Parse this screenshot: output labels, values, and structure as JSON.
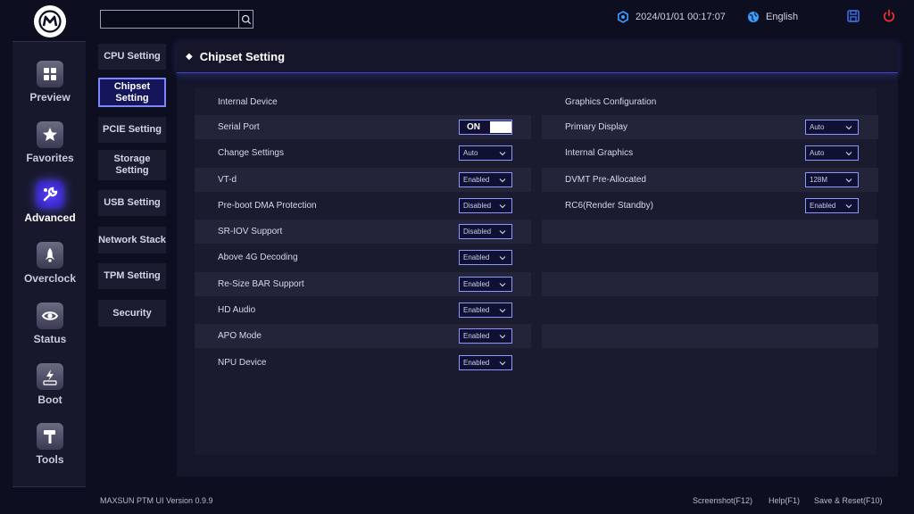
{
  "brand": {
    "colors": {
      "accent": "#5b4bff",
      "power": "#e53030",
      "save": "#3a6ee8"
    }
  },
  "search": {
    "value": "",
    "placeholder": ""
  },
  "topbar": {
    "datetime": "2024/01/01 00:17:07",
    "language": "English"
  },
  "sidebar": {
    "items": [
      {
        "label": "Preview",
        "icon": "grid-icon"
      },
      {
        "label": "Favorites",
        "icon": "star-icon"
      },
      {
        "label": "Advanced",
        "icon": "wrench-icon"
      },
      {
        "label": "Overclock",
        "icon": "rocket-icon"
      },
      {
        "label": "Status",
        "icon": "eye-icon"
      },
      {
        "label": "Boot",
        "icon": "ssd-icon"
      },
      {
        "label": "Tools",
        "icon": "hammer-icon"
      }
    ],
    "active": "Advanced"
  },
  "submenu": {
    "items": [
      "CPU Setting",
      "Chipset Setting",
      "PCIE Setting",
      "Storage Setting",
      "USB Setting",
      "Network Stack",
      "TPM Setting",
      "Security"
    ],
    "active": "Chipset Setting"
  },
  "panel": {
    "title": "Chipset Setting",
    "left": {
      "heading": "Internal Device",
      "rows": [
        {
          "label": "Serial Port",
          "value": "ON",
          "control": "toggle"
        },
        {
          "label": "Change Settings",
          "value": "Auto"
        },
        {
          "label": "VT-d",
          "value": "Enabled"
        },
        {
          "label": "Pre-boot DMA Protection",
          "value": "Disabled"
        },
        {
          "label": "SR-IOV Support",
          "value": "Disabled"
        },
        {
          "label": "Above 4G Decoding",
          "value": "Enabled"
        },
        {
          "label": "Re-Size BAR Support",
          "value": "Enabled"
        },
        {
          "label": "HD Audio",
          "value": "Enabled"
        },
        {
          "label": "APO Mode",
          "value": "Enabled"
        },
        {
          "label": "NPU Device",
          "value": "Enabled"
        }
      ]
    },
    "right": {
      "heading": "Graphics Configuration",
      "rows": [
        {
          "label": "Primary Display",
          "value": "Auto"
        },
        {
          "label": "Internal Graphics",
          "value": "Auto"
        },
        {
          "label": "DVMT Pre-Allocated",
          "value": "128M"
        },
        {
          "label": "RC6(Render Standby)",
          "value": "Enabled"
        }
      ]
    }
  },
  "footer": {
    "version": "MAXSUN PTM UI Version 0.9.9",
    "screenshot": "Screenshot(F12)",
    "help": "Help(F1)",
    "save_reset": "Save & Reset(F10)"
  }
}
